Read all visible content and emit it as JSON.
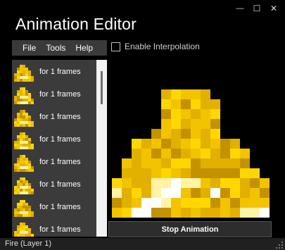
{
  "window": {
    "title": "Animation Editor",
    "controls": {
      "minimize": "—",
      "maximize": "☐",
      "close": "✕"
    }
  },
  "menu": {
    "items": [
      "File",
      "Tools",
      "Help"
    ]
  },
  "options": {
    "interpolation_label": "Enable Interpolation",
    "interpolation_checked": false
  },
  "frames": [
    {
      "label": "for 1 frames"
    },
    {
      "label": "for 1 frames"
    },
    {
      "label": "for 1 frames"
    },
    {
      "label": "for 1 frames"
    },
    {
      "label": "for 1 frames"
    },
    {
      "label": "for 1 frames"
    },
    {
      "label": "for 1 frames"
    },
    {
      "label": "for 1 frames"
    }
  ],
  "controls": {
    "stop_label": "Stop Animation"
  },
  "status": {
    "text": "Fire (Layer 1)"
  },
  "colors": {
    "bright_gold": "#FFD700",
    "gold": "#F3C300",
    "mid_gold": "#E1B000",
    "dark_gold": "#C49200",
    "light_yellow": "#FFF3A6",
    "white": "#FFFFFF"
  }
}
